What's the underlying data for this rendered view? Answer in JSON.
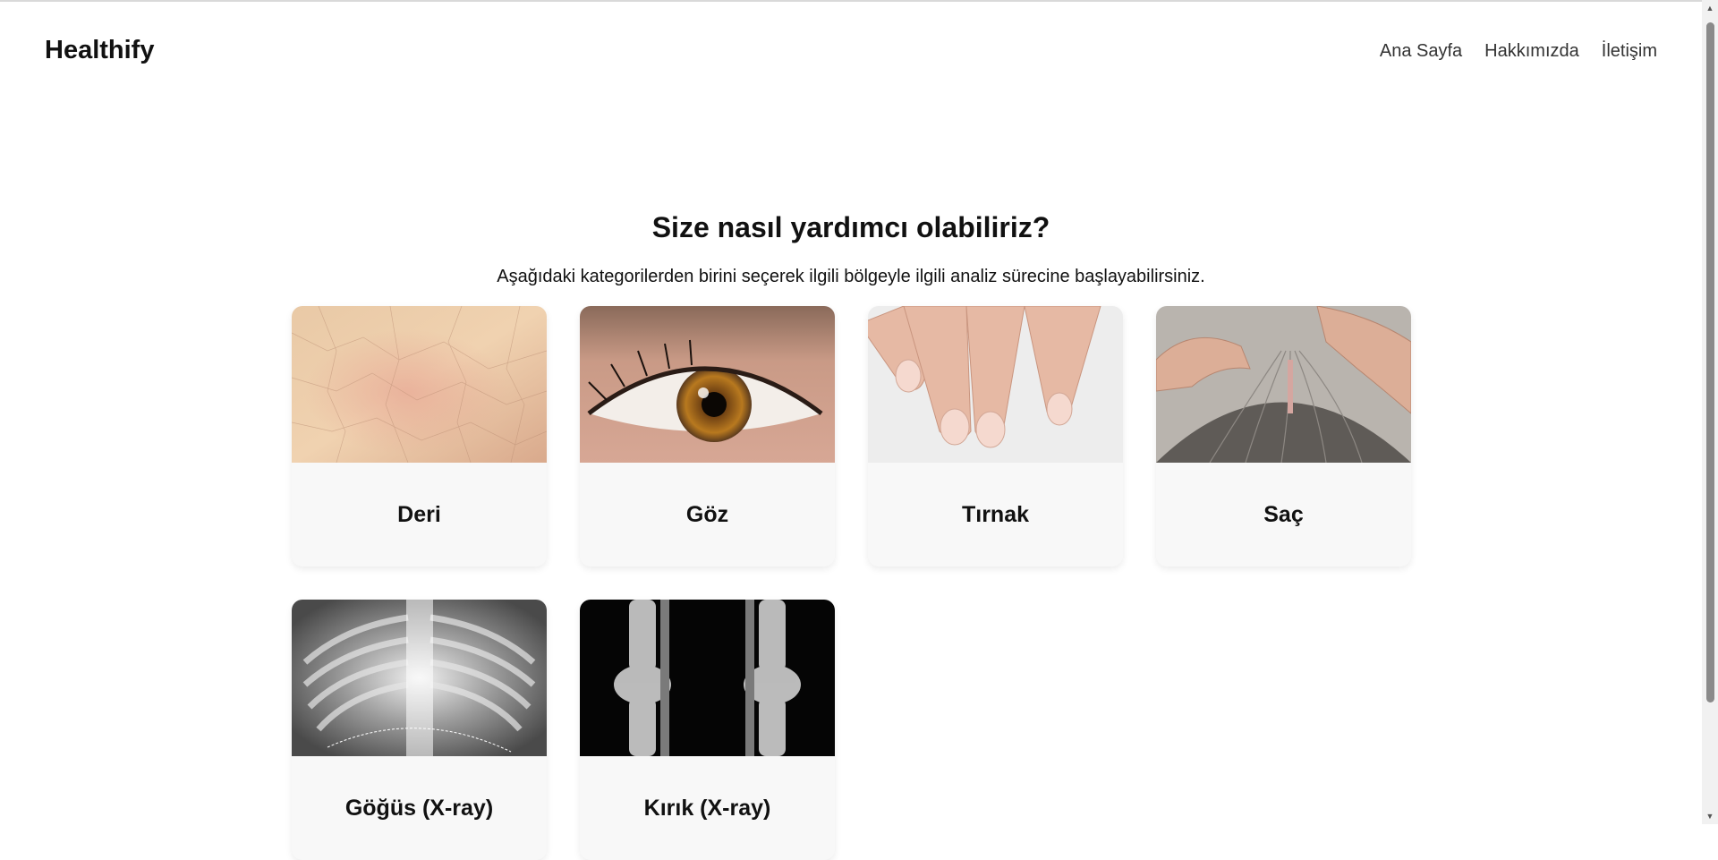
{
  "header": {
    "brand": "Healthify",
    "nav": [
      "Ana Sayfa",
      "Hakkımızda",
      "İletişim"
    ]
  },
  "main": {
    "title": "Size nasıl yardımcı olabiliriz?",
    "subtitle": "Aşağıdaki kategorilerden birini seçerek ilgili bölgeyle ilgili analiz sürecine başlayabilirsiniz.",
    "categories": [
      {
        "label": "Deri",
        "icon": "skin-image"
      },
      {
        "label": "Göz",
        "icon": "eye-image"
      },
      {
        "label": "Tırnak",
        "icon": "nail-image"
      },
      {
        "label": "Saç",
        "icon": "hair-image"
      },
      {
        "label": "Göğüs (X-ray)",
        "icon": "chest-xray-image"
      },
      {
        "label": "Kırık (X-ray)",
        "icon": "knee-xray-image"
      }
    ]
  },
  "colors": {
    "background": "#ffffff",
    "card": "#f8f8f8",
    "text": "#111111",
    "nav_text": "#333333"
  }
}
